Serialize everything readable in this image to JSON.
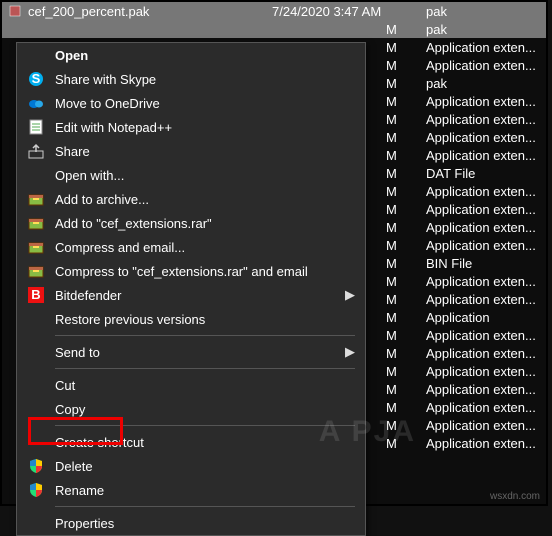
{
  "selected_file": {
    "name": "cef_200_percent.pak",
    "date": "7/24/2020 3:47 AM",
    "type": "pak"
  },
  "rows": [
    {
      "ampm": "M",
      "type": "pak"
    },
    {
      "ampm": "M",
      "type": "Application exten..."
    },
    {
      "ampm": "M",
      "type": "Application exten..."
    },
    {
      "ampm": "M",
      "type": "pak"
    },
    {
      "ampm": "M",
      "type": "Application exten..."
    },
    {
      "ampm": "M",
      "type": "Application exten..."
    },
    {
      "ampm": "M",
      "type": "Application exten..."
    },
    {
      "ampm": "M",
      "type": "Application exten..."
    },
    {
      "ampm": "M",
      "type": "DAT File"
    },
    {
      "ampm": "M",
      "type": "Application exten..."
    },
    {
      "ampm": "M",
      "type": "Application exten..."
    },
    {
      "ampm": "M",
      "type": "Application exten..."
    },
    {
      "ampm": "M",
      "type": "Application exten..."
    },
    {
      "ampm": "M",
      "type": "BIN File"
    },
    {
      "ampm": "M",
      "type": "Application exten..."
    },
    {
      "ampm": "M",
      "type": "Application exten..."
    },
    {
      "ampm": "M",
      "type": "Application"
    },
    {
      "ampm": "M",
      "type": "Application exten..."
    },
    {
      "ampm": "M",
      "type": "Application exten..."
    },
    {
      "ampm": "M",
      "type": "Application exten..."
    },
    {
      "ampm": "M",
      "type": "Application exten..."
    },
    {
      "ampm": "M",
      "type": "Application exten..."
    },
    {
      "ampm": "M",
      "type": "Application exten..."
    },
    {
      "ampm": "M",
      "type": "Application exten..."
    }
  ],
  "menu": {
    "open": "Open",
    "share_skype": "Share with Skype",
    "onedrive": "Move to OneDrive",
    "notepadpp": "Edit with Notepad++",
    "share": "Share",
    "open_with": "Open with...",
    "add_archive": "Add to archive...",
    "add_rar": "Add to \"cef_extensions.rar\"",
    "compress_email": "Compress and email...",
    "compress_rar_email": "Compress to \"cef_extensions.rar\" and email",
    "bitdefender": "Bitdefender",
    "restore": "Restore previous versions",
    "send_to": "Send to",
    "cut": "Cut",
    "copy": "Copy",
    "create_shortcut": "Create shortcut",
    "delete": "Delete",
    "rename": "Rename",
    "properties": "Properties"
  },
  "watermark": "A  PJA",
  "srctag": "wsxdn.com"
}
